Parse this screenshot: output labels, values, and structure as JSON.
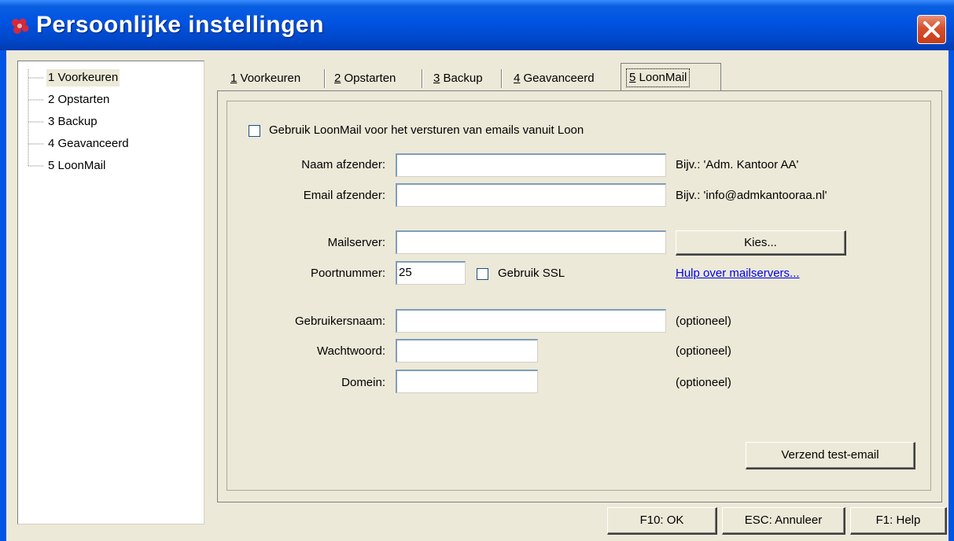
{
  "window": {
    "title": "Persoonlijke instellingen",
    "title_color": "#0054e3"
  },
  "tree": {
    "items": [
      {
        "label": "1 Voorkeuren",
        "selected": true
      },
      {
        "label": "2 Opstarten"
      },
      {
        "label": "3 Backup"
      },
      {
        "label": "4 Geavanceerd"
      },
      {
        "label": "5 LoonMail"
      }
    ]
  },
  "tabs": [
    {
      "key": "1",
      "rest": " Voorkeuren"
    },
    {
      "key": "2",
      "rest": " Opstarten"
    },
    {
      "key": "3",
      "rest": " Backup"
    },
    {
      "key": "4",
      "rest": " Geavanceerd"
    },
    {
      "key": "5",
      "rest": " LoonMail",
      "active": true
    }
  ],
  "loonmail": {
    "use_label": "Gebruik LoonMail voor het versturen van emails vanuit Loon",
    "sender_name_label": "Naam afzender:",
    "sender_name_value": "",
    "sender_name_hint": "Bijv.: 'Adm. Kantoor AA'",
    "sender_email_label": "Email afzender:",
    "sender_email_value": "",
    "sender_email_hint": "Bijv.: 'info@admkantooraa.nl'",
    "mailserver_label": "Mailserver:",
    "mailserver_value": "",
    "choose_button": "Kies...",
    "port_label": "Poortnummer:",
    "port_value": "25",
    "ssl_label": "Gebruik SSL",
    "help_link": "Hulp over mailservers...",
    "username_label": "Gebruikersnaam:",
    "username_value": "",
    "username_hint": "(optioneel)",
    "password_label": "Wachtwoord:",
    "password_value": "",
    "password_hint": "(optioneel)",
    "domain_label": "Domein:",
    "domain_value": "",
    "domain_hint": "(optioneel)",
    "test_button": "Verzend test-email"
  },
  "footer": {
    "ok": "F10: OK",
    "cancel": "ESC: Annuleer",
    "help": "F1: Help"
  }
}
